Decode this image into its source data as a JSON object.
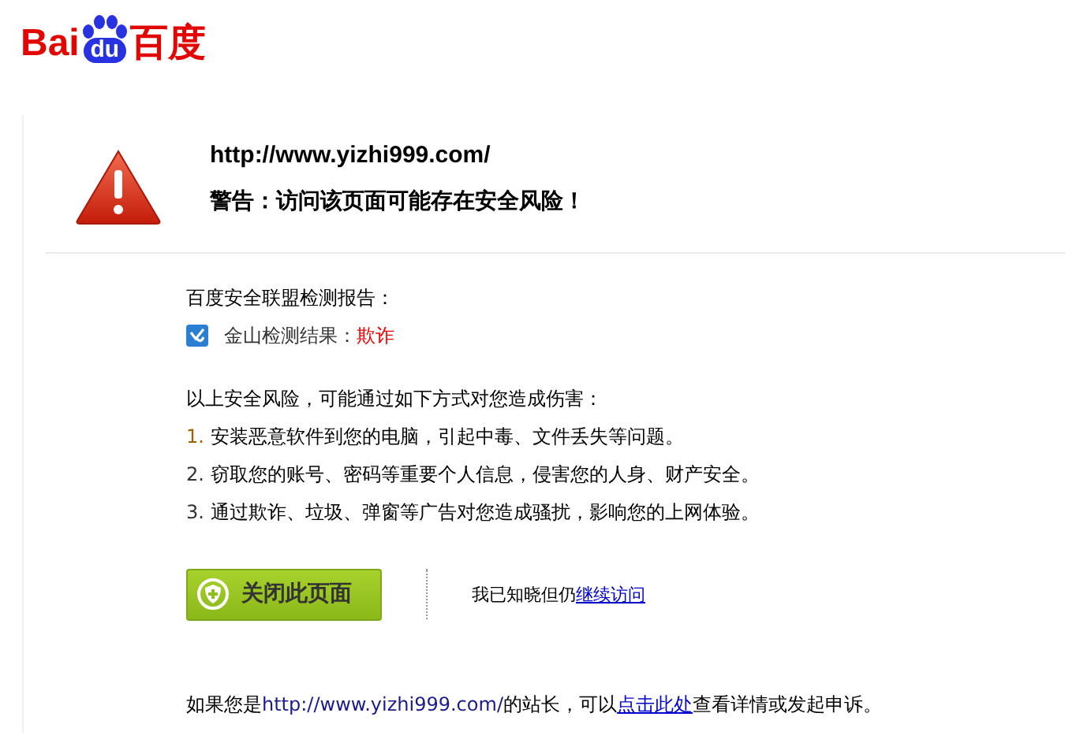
{
  "logo": {
    "parts": [
      "Bai",
      "du",
      "百度"
    ]
  },
  "header": {
    "url": "http://www.yizhi999.com/",
    "warning": "警告：访问该页面可能存在安全风险！"
  },
  "report": {
    "title": "百度安全联盟检测报告：",
    "result_label": "金山检测结果：",
    "result_value": "欺诈"
  },
  "risks": {
    "intro": "以上安全风险，可能通过如下方式对您造成伤害：",
    "items": [
      {
        "number": "1.",
        "text": "安装恶意软件到您的电脑，引起中毒、文件丢失等问题。"
      },
      {
        "number": "2.",
        "text": "窃取您的账号、密码等重要个人信息，侵害您的人身、财产安全。"
      },
      {
        "number": "3.",
        "text": "通过欺诈、垃圾、弹窗等广告对您造成骚扰，影响您的上网体验。"
      }
    ]
  },
  "actions": {
    "close_button": "关闭此页面",
    "continue_text": "我已知晓但仍",
    "continue_link": "继续访问"
  },
  "footer": {
    "before": "如果您是",
    "url": "http://www.yizhi999.com/",
    "middle": "的站长，可以",
    "link": "点击此处",
    "after": "查看详情或发起申诉。"
  }
}
